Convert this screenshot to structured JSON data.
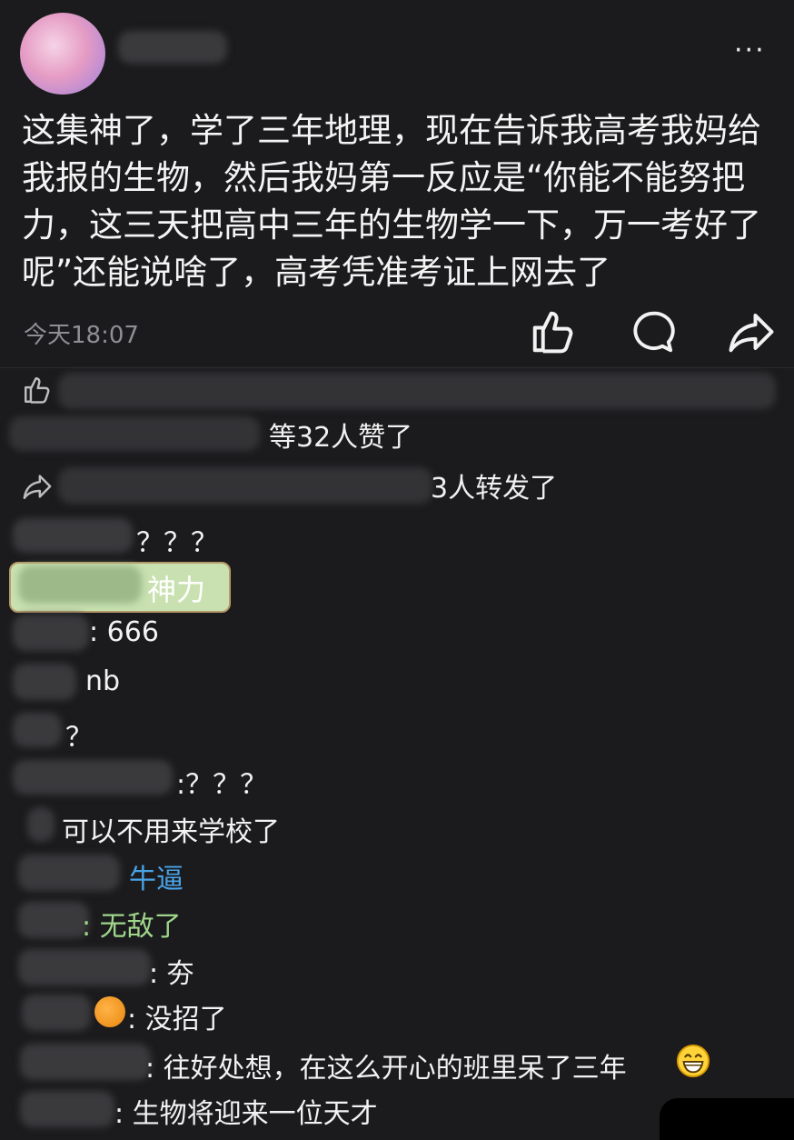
{
  "post": {
    "menu_label": "···",
    "text": "这集神了，学了三年地理，现在告诉我高考我妈给我报的生物，然后我妈第一反应是“你能不能努把力，这三天把高中三年的生物学一下，万一考好了呢”还能说啥了，高考凭准考证上网去了",
    "time": "今天18:07"
  },
  "icons": [
    "like-icon",
    "comment-icon",
    "share-icon",
    "more-icon"
  ],
  "likes": {
    "summary": "等32人赞了"
  },
  "shares": {
    "summary": "3人转发了"
  },
  "comments": [
    {
      "text": "？？？"
    },
    {
      "text": "神力"
    },
    {
      "text": ": 666"
    },
    {
      "text": "nb"
    },
    {
      "text": "？"
    },
    {
      "text": ":？？？"
    },
    {
      "text": "可以不用来学校了"
    },
    {
      "text": "牛逼"
    },
    {
      "text": ": 无敌了"
    },
    {
      "text": ": 夯"
    },
    {
      "text": ": 没招了"
    },
    {
      "text": ": 往好处想，在这么开心的班里呆了三年"
    },
    {
      "text": ": 生物将迎来一位天才"
    }
  ],
  "colors": {
    "background": "#1b1b1d",
    "blue_text": "#4aa3e8",
    "green_text": "#9fd68a",
    "badge": "#c9e1b0"
  }
}
